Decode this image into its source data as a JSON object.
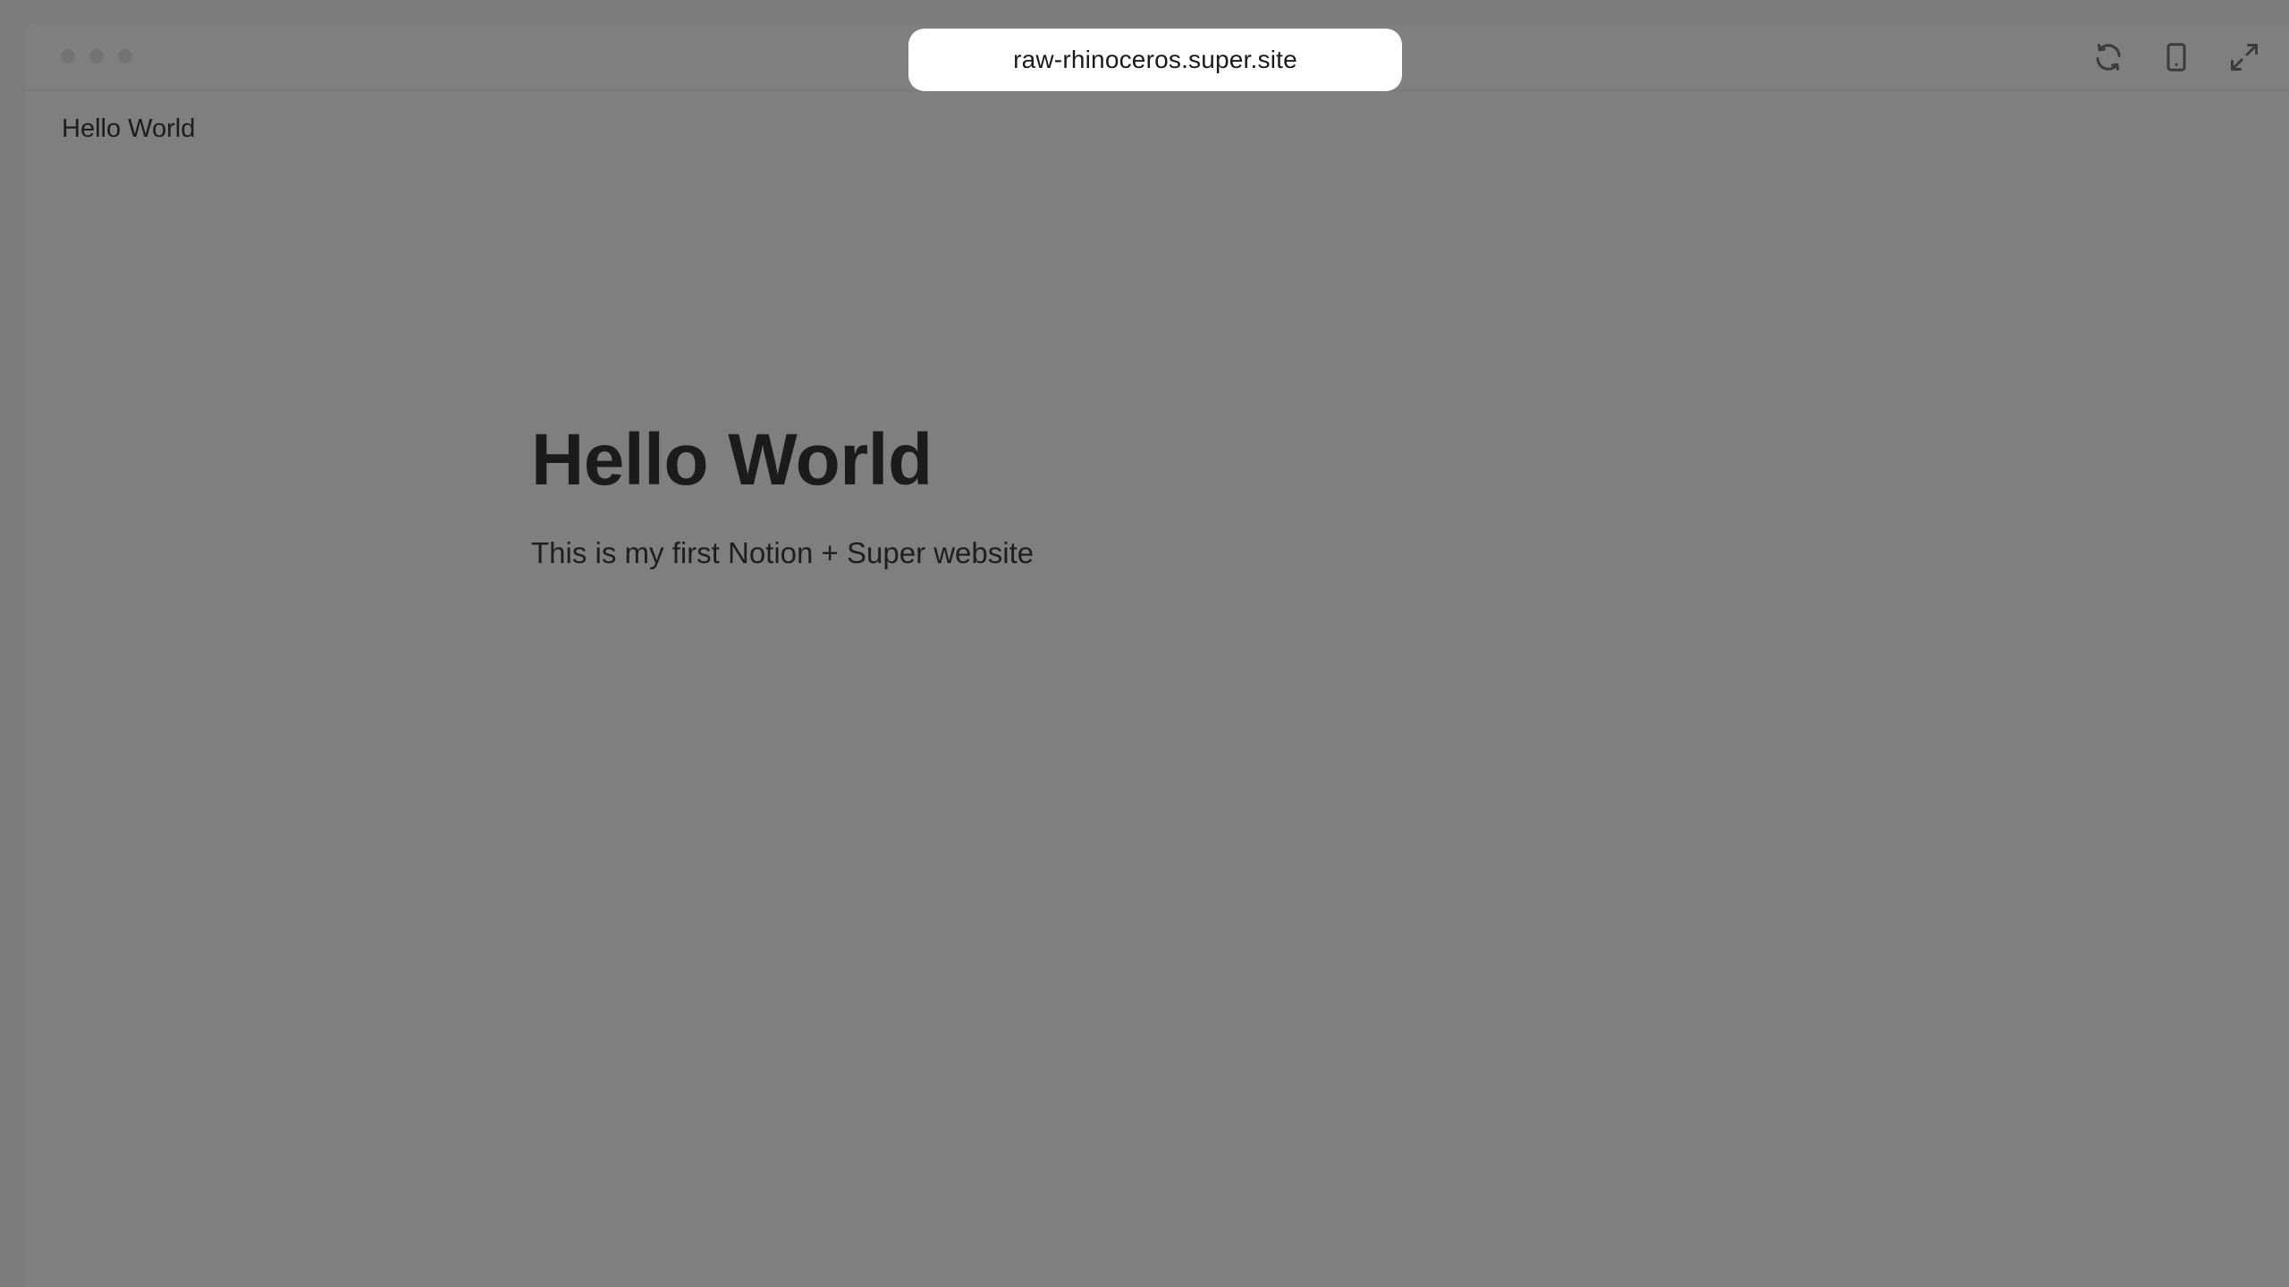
{
  "browser": {
    "url": "raw-rhinoceros.super.site",
    "tools": {
      "refresh": "refresh-icon",
      "mobile": "mobile-device-icon",
      "expand": "expand-icon"
    }
  },
  "site": {
    "nav_title": "Hello World",
    "heading": "Hello World",
    "paragraph": "This is my first Notion + Super website"
  },
  "colors": {
    "background": "#7f7f7f",
    "url_pill": "#ffffff",
    "text": "#1b1b1b"
  }
}
